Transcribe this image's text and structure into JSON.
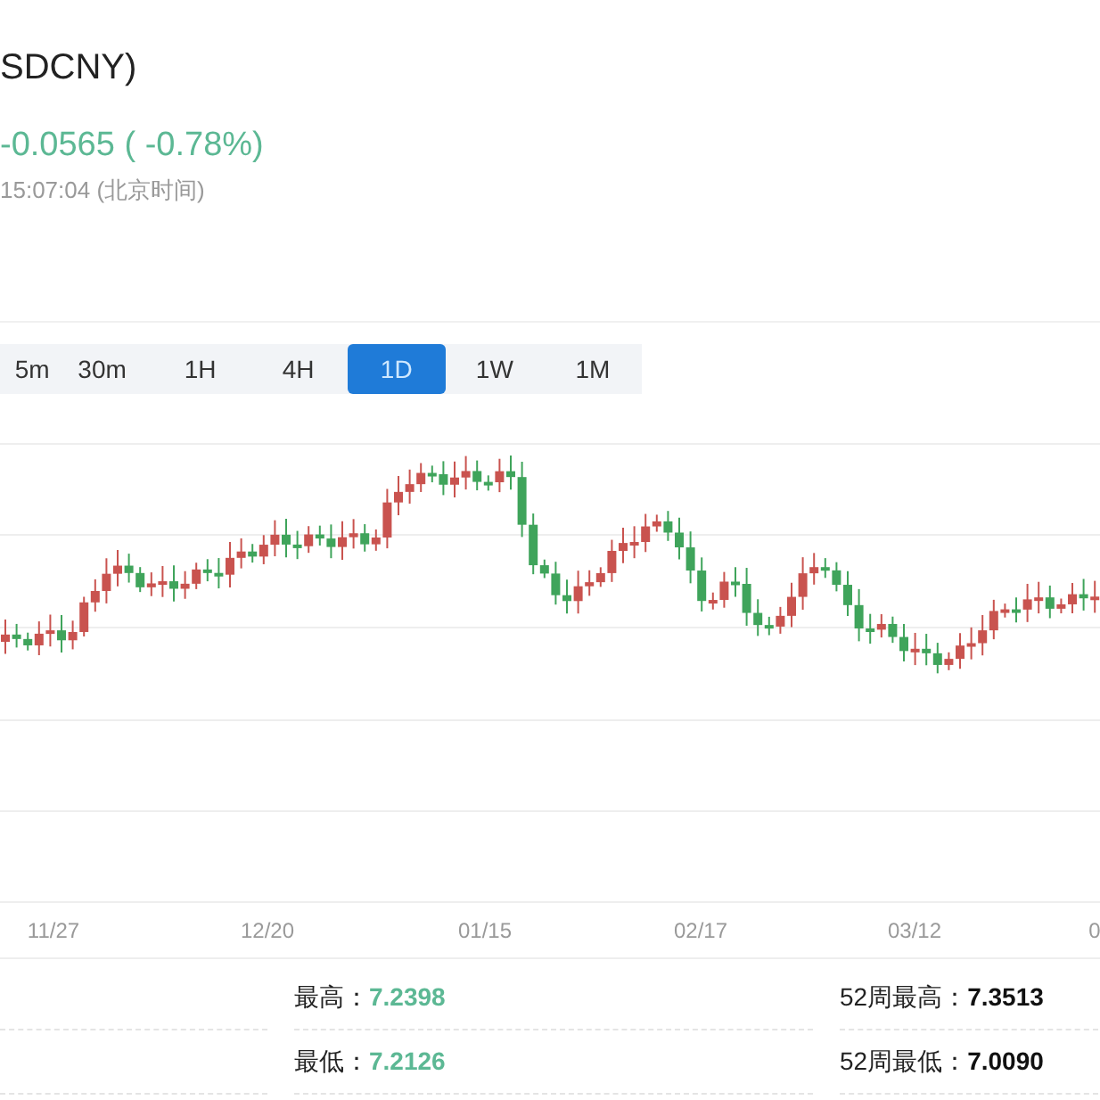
{
  "header": {
    "title": "SDCNY)",
    "change": "-0.0565 ( -0.78%)",
    "time": "15:07:04  (北京时间)"
  },
  "tabs": [
    {
      "label": "5m",
      "selected": false
    },
    {
      "label": "30m",
      "selected": false
    },
    {
      "label": "1H",
      "selected": false
    },
    {
      "label": "4H",
      "selected": false
    },
    {
      "label": "1D",
      "selected": true
    },
    {
      "label": "1W",
      "selected": false
    },
    {
      "label": "1M",
      "selected": false
    }
  ],
  "chart": {
    "x_labels": [
      "11/27",
      "12/20",
      "01/15",
      "02/17",
      "03/12",
      "0"
    ]
  },
  "stats": [
    {
      "label": "最高：",
      "value": "7.2398",
      "kind": "change"
    },
    {
      "label": "52周最高：",
      "value": "7.3513",
      "kind": "plain"
    },
    {
      "label": "最低：",
      "value": "7.2126",
      "kind": "change"
    },
    {
      "label": "52周最低：",
      "value": "7.0090",
      "kind": "plain"
    }
  ]
}
